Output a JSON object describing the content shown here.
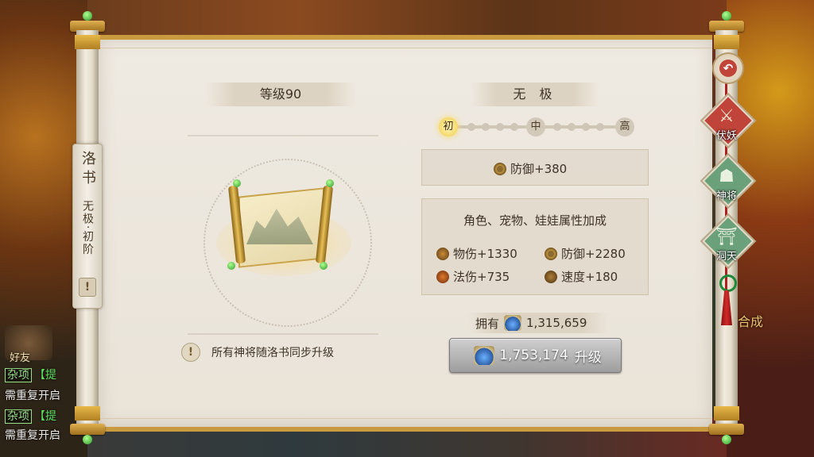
{
  "background": {
    "friend_label": "好友",
    "chat_lines": [
      {
        "tag": "杂项",
        "green": "【提",
        "text": ""
      },
      {
        "tag": "",
        "green": "",
        "text": "需重复开启"
      },
      {
        "tag": "杂项",
        "green": "【提",
        "text": ""
      },
      {
        "tag": "",
        "green": "",
        "text": "需重复开启"
      }
    ],
    "right_fragment": "合成"
  },
  "side_tab": {
    "title": "洛书",
    "subtitle": "无极·初阶",
    "warn_glyph": "!"
  },
  "left": {
    "level_label": "等级90",
    "tip_icon": "!",
    "tip_text": "所有神将随洛书同步升级"
  },
  "right": {
    "tier_title": "无 极",
    "track_nodes": [
      {
        "label": "初",
        "active": true
      },
      {
        "label": "中",
        "active": false
      },
      {
        "label": "高",
        "active": false
      }
    ],
    "main_stat": {
      "icon": "shield-icon",
      "text": "防御+380"
    },
    "bonus_title": "角色、宠物、娃娃属性加成",
    "bonus_stats": [
      {
        "icon": "sword-icon",
        "text": "物伤+1330"
      },
      {
        "icon": "shield-icon",
        "text": "防御+2280"
      },
      {
        "icon": "fire-icon",
        "text": "法伤+735"
      },
      {
        "icon": "speed-icon",
        "text": "速度+180"
      }
    ],
    "own_label": "拥有",
    "own_amount": "1,315,659",
    "upgrade_cost": "1,753,174",
    "upgrade_label": "升级"
  },
  "nav": {
    "back_glyph": "↶",
    "items": [
      {
        "label": "伏妖",
        "icon": "crossed-swords-icon",
        "active": true
      },
      {
        "label": "神将",
        "icon": "general-icon",
        "active": false
      },
      {
        "label": "洞天",
        "icon": "pagoda-icon",
        "active": false
      }
    ]
  },
  "colors": {
    "paper": "#efeae2",
    "gold": "#c99a3e",
    "text": "#3e3226",
    "active_tab": "#c0443a",
    "inactive_tab": "#6aa07a"
  }
}
